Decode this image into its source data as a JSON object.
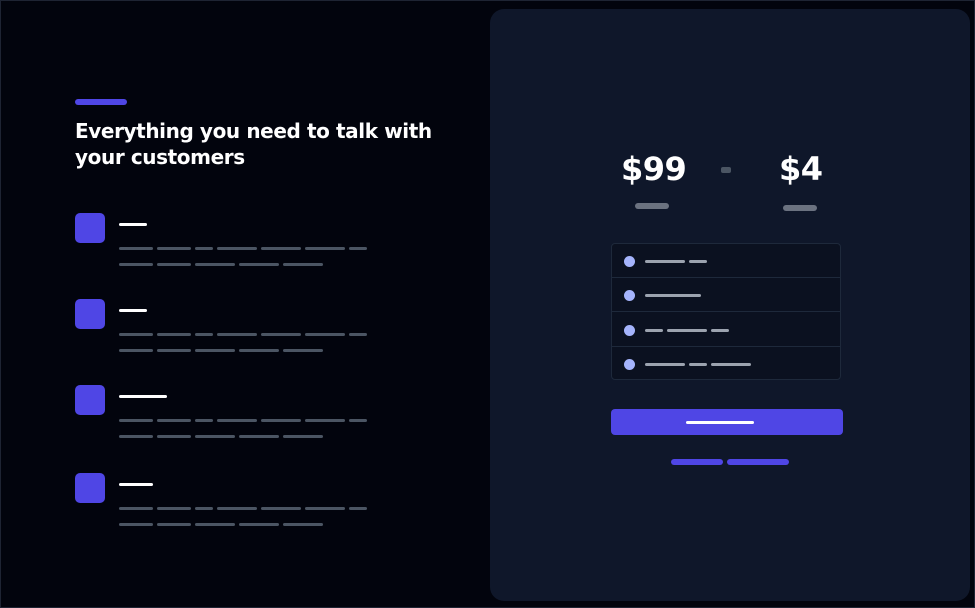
{
  "hero": {
    "headline": "Everything you need to talk with your customers"
  },
  "pricing": {
    "old_price": "$99",
    "new_price": "$4"
  },
  "colors": {
    "background": "#02040d",
    "card": "#0f172a",
    "accent": "#4f46e5",
    "dot": "#a5b4fc",
    "placeholder_line": "#4b5563",
    "list_line": "#9ca3af"
  },
  "icons": {
    "feature_icon": "square-icon",
    "list_bullet": "bullet-dot-icon"
  }
}
